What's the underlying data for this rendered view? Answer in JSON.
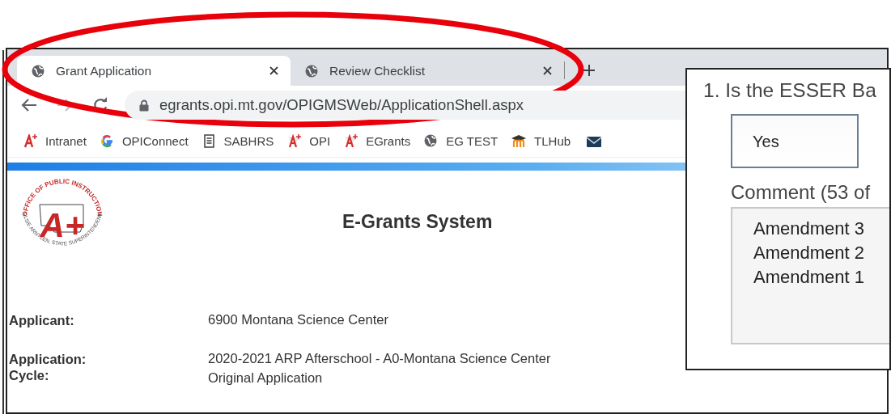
{
  "tabs": [
    {
      "title": "Grant Application",
      "selected": true
    },
    {
      "title": "Review Checklist",
      "selected": false
    }
  ],
  "address": "egrants.opi.mt.gov/OPIGMSWeb/ApplicationShell.aspx",
  "bookmarks": [
    {
      "kind": "aplus",
      "label": "Intranet"
    },
    {
      "kind": "google",
      "label": "OPIConnect"
    },
    {
      "kind": "doc",
      "label": "SABHRS"
    },
    {
      "kind": "aplus-outline",
      "label": "OPI"
    },
    {
      "kind": "aplus-outline",
      "label": "EGrants"
    },
    {
      "kind": "globe",
      "label": "EG TEST"
    },
    {
      "kind": "mortarboard",
      "label": "TLHub"
    },
    {
      "kind": "mail"
    }
  ],
  "logo": {
    "mark": "A+",
    "top_text": "OFFICE OF PUBLIC INSTRUCTION",
    "bottom_text": "ELSIE ARNTZEN, STATE SUPERINTENDENT"
  },
  "page_title": "E-Grants System",
  "fields": [
    {
      "labels": [
        "Applicant:"
      ],
      "values": [
        "6900 Montana Science Center"
      ]
    },
    {
      "labels": [
        "Application:",
        "Cycle:"
      ],
      "values": [
        "2020-2021 ARP Afterschool - A0-Montana Science Center",
        "Original Application"
      ]
    }
  ],
  "checklist_panel": {
    "question": "1. Is the ESSER Ba",
    "answer": "Yes",
    "comment_label": "Comment (53 of",
    "comment_lines": [
      "Amendment 3",
      "Amendment 2",
      "Amendment 1"
    ]
  }
}
